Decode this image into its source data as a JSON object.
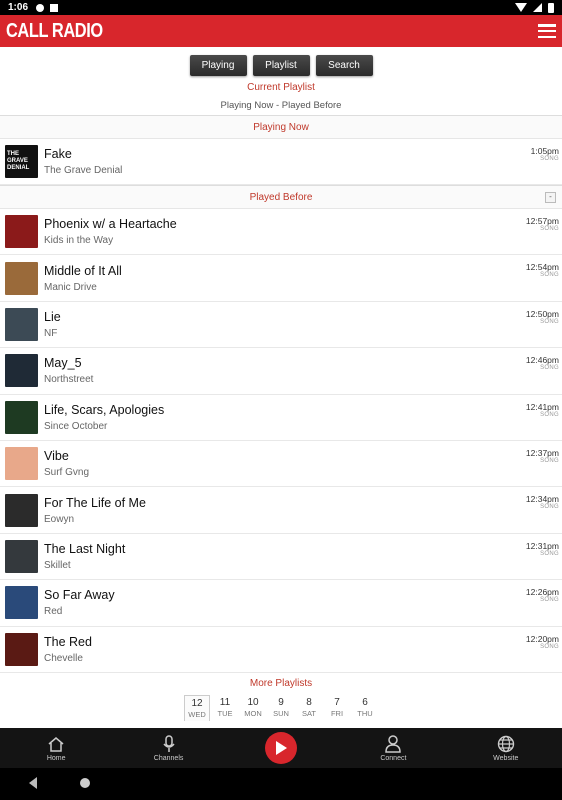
{
  "status_bar": {
    "time": "1:06"
  },
  "app": {
    "title": "CALL RADIO",
    "accent": "#d8262c"
  },
  "tabs": [
    {
      "label": "Playing"
    },
    {
      "label": "Playlist"
    },
    {
      "label": "Search"
    }
  ],
  "playlist": {
    "current_label": "Current Playlist",
    "subtitle": "Playing Now - Played Before"
  },
  "playing_now": {
    "header": "Playing Now",
    "song": {
      "title": "Fake",
      "artist": "The Grave Denial",
      "time": "1:05pm",
      "type": "SONG",
      "art_text": "THE GRAVE DENIAL",
      "art_color": "#111"
    }
  },
  "played_before": {
    "header": "Played Before",
    "collapse_label": "-",
    "songs": [
      {
        "title": "Phoenix w/ a Heartache",
        "artist": "Kids in the Way",
        "time": "12:57pm",
        "type": "SONG",
        "art_color": "#8b1a1a"
      },
      {
        "title": "Middle of It All",
        "artist": "Manic Drive",
        "time": "12:54pm",
        "type": "SONG",
        "art_color": "#9a6a3a"
      },
      {
        "title": "Lie",
        "artist": "NF",
        "time": "12:50pm",
        "type": "SONG",
        "art_color": "#3c4a55"
      },
      {
        "title": "May_5",
        "artist": "Northstreet",
        "time": "12:46pm",
        "type": "SONG",
        "art_color": "#1f2a36"
      },
      {
        "title": "Life, Scars, Apologies",
        "artist": "Since October",
        "time": "12:41pm",
        "type": "SONG",
        "art_color": "#1e3a22"
      },
      {
        "title": "Vibe",
        "artist": "Surf Gvng",
        "time": "12:37pm",
        "type": "SONG",
        "art_color": "#e8a88a"
      },
      {
        "title": "For The Life of Me",
        "artist": "Eowyn",
        "time": "12:34pm",
        "type": "SONG",
        "art_color": "#2b2b2b"
      },
      {
        "title": "The Last Night",
        "artist": "Skillet",
        "time": "12:31pm",
        "type": "SONG",
        "art_color": "#34393d"
      },
      {
        "title": "So Far Away",
        "artist": "Red",
        "time": "12:26pm",
        "type": "SONG",
        "art_color": "#2a4a7a"
      },
      {
        "title": "The Red",
        "artist": "Chevelle",
        "time": "12:20pm",
        "type": "SONG",
        "art_color": "#5a1a14"
      }
    ]
  },
  "more_playlists": {
    "label": "More Playlists",
    "days": [
      {
        "num": "12",
        "name": "WED",
        "active": true
      },
      {
        "num": "11",
        "name": "TUE"
      },
      {
        "num": "10",
        "name": "MON"
      },
      {
        "num": "9",
        "name": "SUN"
      },
      {
        "num": "8",
        "name": "SAT"
      },
      {
        "num": "7",
        "name": "FRI"
      },
      {
        "num": "6",
        "name": "THU"
      }
    ]
  },
  "bottom_nav": {
    "home": "Home",
    "channels": "Channels",
    "connect": "Connect",
    "website": "Website"
  }
}
